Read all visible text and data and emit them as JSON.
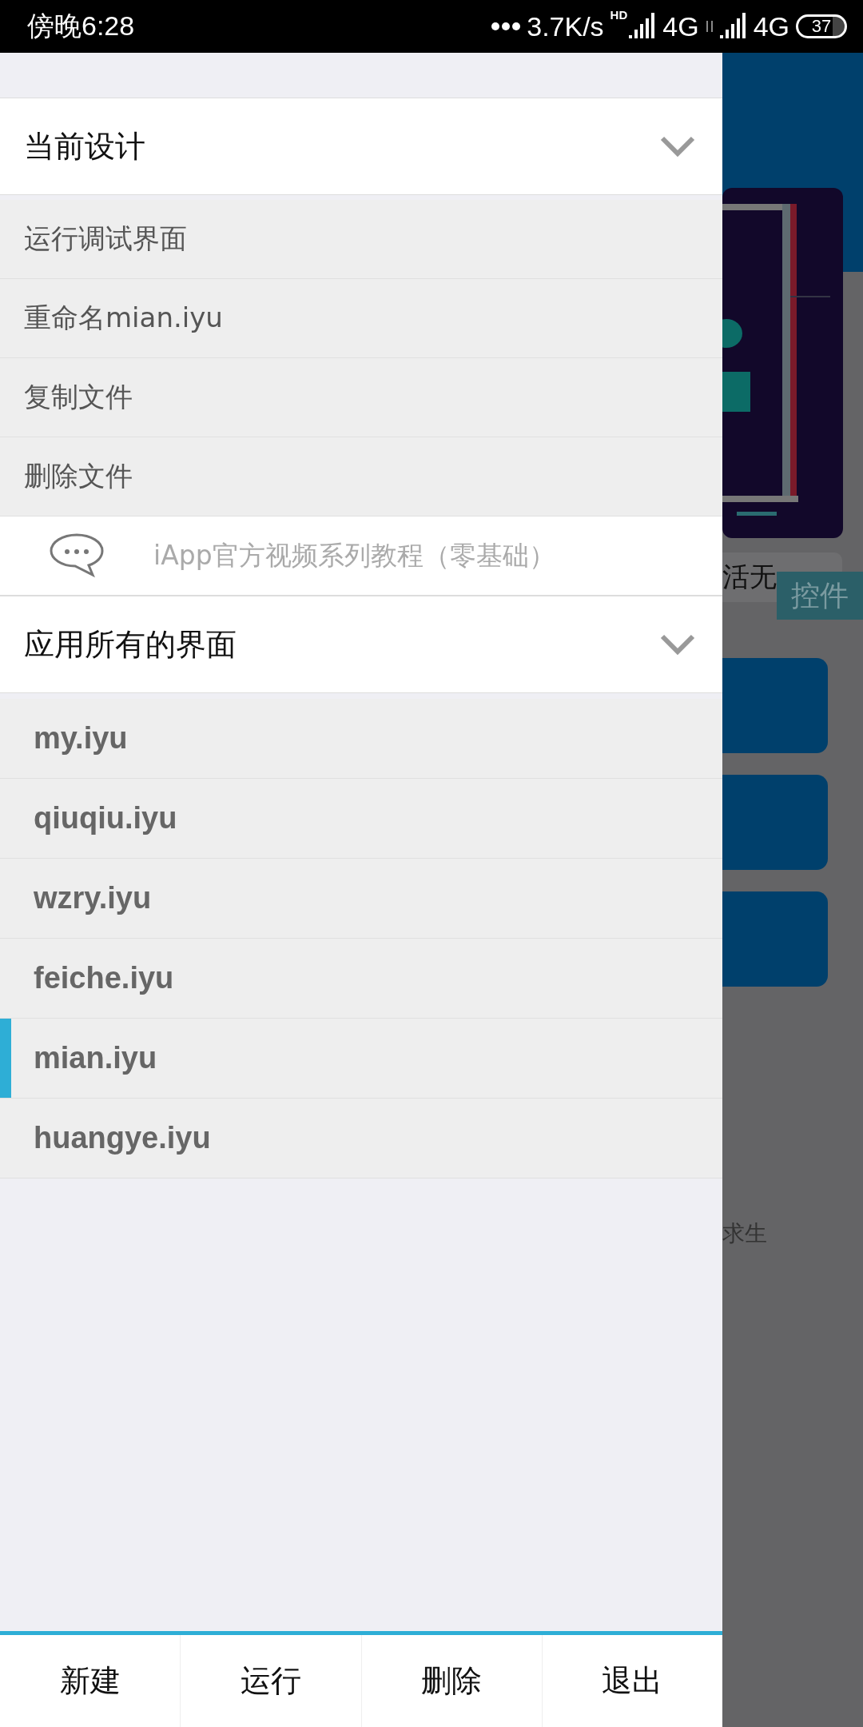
{
  "status_bar": {
    "time": "傍晚6:28",
    "speed": "3.7K/s",
    "hd": "HD",
    "networks": [
      "4G",
      "4G"
    ],
    "battery": "37"
  },
  "drawer": {
    "design_section": {
      "title": "当前设计",
      "items": [
        "运行调试界面",
        "重命名mian.iyu",
        "复制文件",
        "删除文件"
      ]
    },
    "tutorial": "iApp官方视频系列教程（零基础）",
    "screens_section": {
      "title": "应用所有的界面",
      "items": [
        {
          "label": "my.iyu",
          "selected": false
        },
        {
          "label": "qiuqiu.iyu",
          "selected": false
        },
        {
          "label": "wzry.iyu",
          "selected": false
        },
        {
          "label": "feiche.iyu",
          "selected": false
        },
        {
          "label": "mian.iyu",
          "selected": true
        },
        {
          "label": "huangye.iyu",
          "selected": false
        }
      ]
    },
    "bottom_buttons": [
      "新建",
      "运行",
      "删除",
      "退出"
    ]
  },
  "background": {
    "caption": "活无",
    "badge": "控件",
    "footer_text": "求生"
  }
}
